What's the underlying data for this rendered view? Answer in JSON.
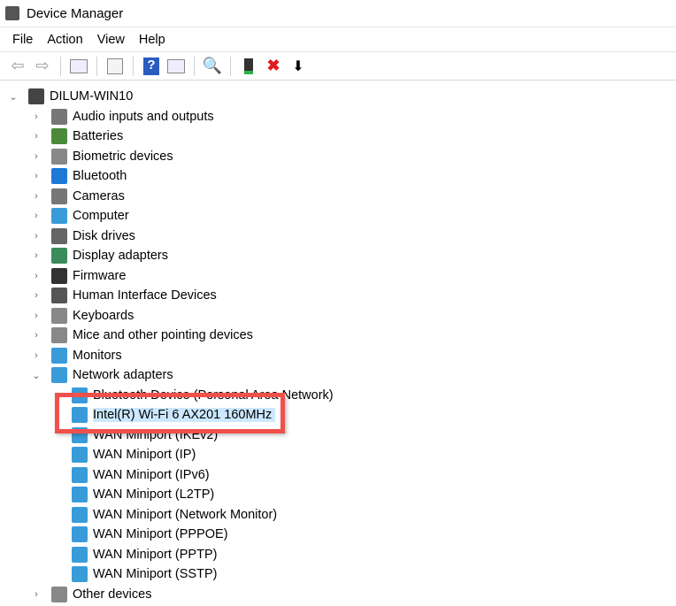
{
  "window": {
    "title": "Device Manager"
  },
  "menu": [
    "File",
    "Action",
    "View",
    "Help"
  ],
  "toolbar": [
    "back-icon",
    "forward-icon",
    "show-hide-tree-icon",
    "properties-icon",
    "help-icon",
    "action-pane-icon",
    "scan-hardware-icon",
    "update-driver-icon",
    "uninstall-icon",
    "disable-icon"
  ],
  "tree": {
    "root": "DILUM-WIN10",
    "categories": [
      "Audio inputs and outputs",
      "Batteries",
      "Biometric devices",
      "Bluetooth",
      "Cameras",
      "Computer",
      "Disk drives",
      "Display adapters",
      "Firmware",
      "Human Interface Devices",
      "Keyboards",
      "Mice and other pointing devices",
      "Monitors",
      "Network adapters"
    ],
    "network_children": [
      "Bluetooth Device (Personal Area Network)",
      "Intel(R) Wi-Fi 6 AX201 160MHz",
      "WAN Miniport (IKEv2)",
      "WAN Miniport (IP)",
      "WAN Miniport (IPv6)",
      "WAN Miniport (L2TP)",
      "WAN Miniport (Network Monitor)",
      "WAN Miniport (PPPOE)",
      "WAN Miniport (PPTP)",
      "WAN Miniport (SSTP)"
    ],
    "after": [
      "Other devices"
    ]
  },
  "colors": {
    "highlight": "#f0504a",
    "selection": "#cce8ff"
  }
}
